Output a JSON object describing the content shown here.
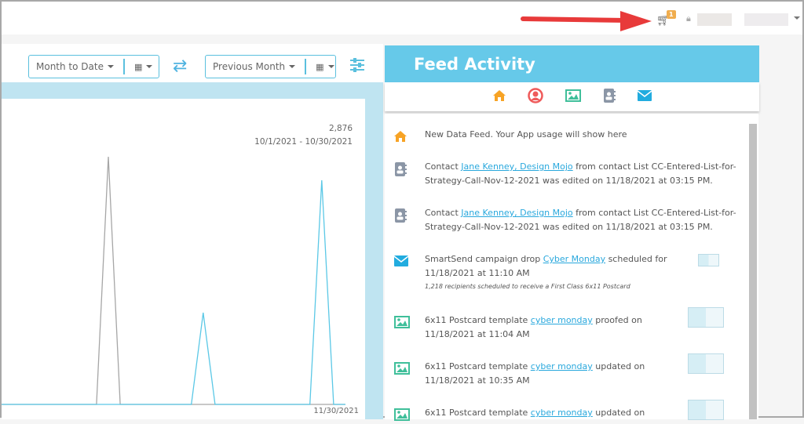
{
  "header": {
    "cart_icon": "shopping-cart-icon",
    "cart_count": "1",
    "user_icon": "lock-icon"
  },
  "toolbar": {
    "range1": {
      "label": "Month to Date",
      "icon": "calendar-icon"
    },
    "swap_icon": "exchange-icon",
    "range2": {
      "label": "Previous Month",
      "icon": "calendar-icon"
    },
    "settings_icon": "sliders-icon"
  },
  "chart_data": {
    "type": "line",
    "total_label": "2,876",
    "range_label": "10/1/2021 - 10/30/2021",
    "x_end_label": "11/30/2021",
    "x": [
      1,
      2,
      3,
      4,
      5,
      6,
      7,
      8,
      9,
      10,
      11,
      12,
      13,
      14,
      15,
      16,
      17,
      18,
      19,
      20,
      21,
      22,
      23,
      24,
      25,
      26,
      27,
      28,
      29,
      30
    ],
    "ylim": [
      0,
      2876
    ],
    "series": [
      {
        "color": "#a6a6a6",
        "values": [
          0,
          0,
          0,
          0,
          0,
          0,
          0,
          0,
          0,
          2876,
          0,
          0,
          0,
          0,
          0,
          0,
          0,
          0,
          0,
          0,
          0,
          0,
          0,
          0,
          0,
          0,
          0,
          0,
          0,
          0
        ]
      },
      {
        "color": "#5bc8e6",
        "values": [
          0,
          0,
          0,
          0,
          0,
          0,
          0,
          0,
          0,
          0,
          0,
          0,
          0,
          0,
          0,
          0,
          0,
          1065,
          0,
          0,
          0,
          0,
          0,
          0,
          0,
          0,
          0,
          2603,
          0,
          0
        ]
      }
    ]
  },
  "feed": {
    "title": "Feed Activity",
    "filters": [
      {
        "icon": "home-icon",
        "color": "#f7a325"
      },
      {
        "icon": "user-circle-icon",
        "color": "#ef5a5a"
      },
      {
        "icon": "image-icon",
        "color": "#3fbf9a"
      },
      {
        "icon": "address-book-icon",
        "color": "#8b96a6"
      },
      {
        "icon": "envelope-icon",
        "color": "#22acdf"
      }
    ],
    "items": [
      {
        "icon": "home-icon",
        "text": "New Data Feed. Your App usage will show here"
      },
      {
        "icon": "address-book-icon",
        "pre": "Contact ",
        "link": "Jane Kenney, Design Mojo",
        "post": " from contact List CC-Entered-List-for-Strategy-Call-Nov-12-2021 was edited on 11/18/2021 at 03:15 PM."
      },
      {
        "icon": "address-book-icon",
        "pre": "Contact ",
        "link": "Jane Kenney, Design Mojo",
        "post": " from contact List CC-Entered-List-for-Strategy-Call-Nov-12-2021 was edited on 11/18/2021 at 03:15 PM."
      },
      {
        "icon": "envelope-icon",
        "pre": "SmartSend campaign drop ",
        "link": "Cyber Monday",
        "post": " scheduled for 11/18/2021 at 11:10 AM",
        "sub": "1,218 recipients scheduled to receive a First Class 6x11 Postcard"
      },
      {
        "icon": "image-icon",
        "pre": "6x11 Postcard template ",
        "link": "cyber monday",
        "post": " proofed on 11/18/2021 at 11:04 AM"
      },
      {
        "icon": "image-icon",
        "pre": "6x11 Postcard template ",
        "link": "cyber monday",
        "post": " updated on 11/18/2021 at 10:35 AM"
      },
      {
        "icon": "image-icon",
        "pre": "6x11 Postcard template ",
        "link": "cyber monday",
        "post": " updated on"
      }
    ]
  }
}
